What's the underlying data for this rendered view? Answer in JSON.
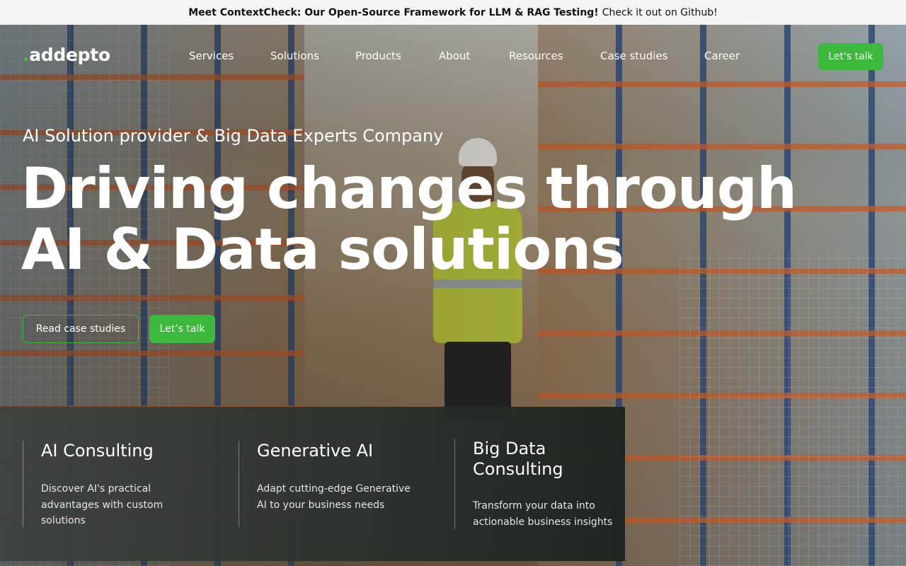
{
  "banner": {
    "bold": "Meet ContextCheck: Our Open-Source Framework for LLM & RAG Testing!",
    "link": "Check it out on Github!"
  },
  "nav": {
    "logo_dot": ".",
    "logo_text": "addepto",
    "items": [
      "Services",
      "Solutions",
      "Products",
      "About",
      "Resources",
      "Case studies",
      "Career"
    ],
    "cta": "Let's talk"
  },
  "hero": {
    "subtitle": "AI Solution provider & Big Data Experts Company",
    "headline_line1": "Driving changes through",
    "headline_line2": "AI & Data solutions",
    "primary_button": "Read case studies",
    "secondary_button": "Let’s talk"
  },
  "services": [
    {
      "title": "AI Consulting",
      "description": "Discover AI's practical advantages with custom solutions"
    },
    {
      "title": "Generative AI",
      "description": "Adapt cutting-edge Generative AI to your business needs"
    },
    {
      "title": "Big Data Consulting",
      "description": "Transform your data into actionable business insights"
    }
  ],
  "colors": {
    "accent": "#3cb83c",
    "banner_bg": "#f5f5f5",
    "panel_bg": "#2a322c"
  }
}
